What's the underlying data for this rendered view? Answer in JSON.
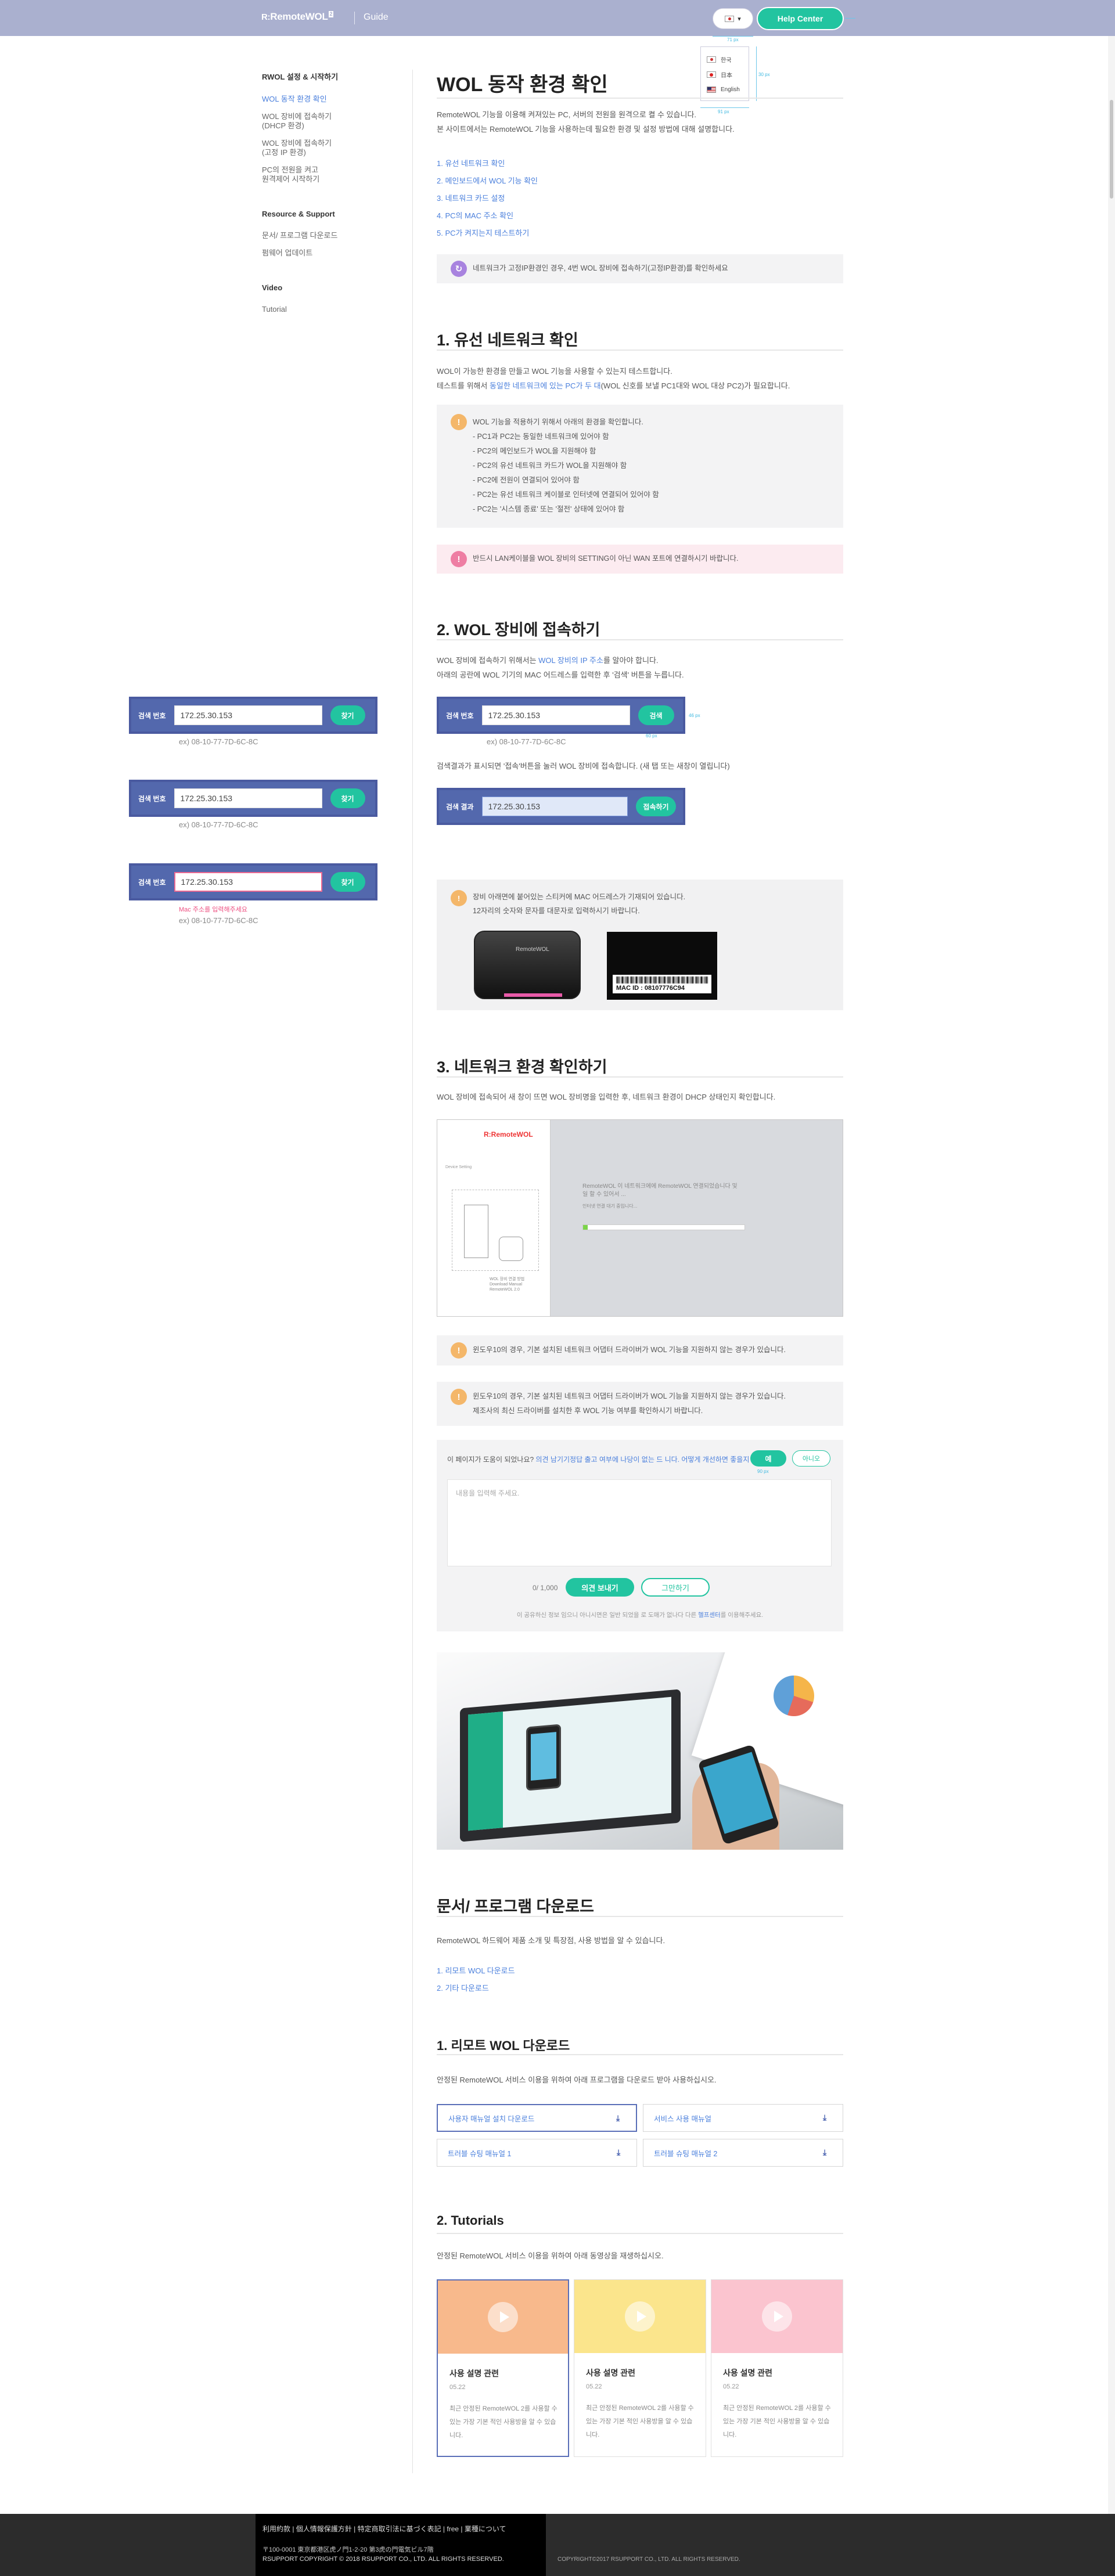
{
  "header": {
    "logo_mark": "R:",
    "logo_text": "RemoteWOL",
    "logo_version": "2",
    "guide": "Guide",
    "lang_code": "KR",
    "help": "Help Center"
  },
  "lang_menu": [
    {
      "label": "한국",
      "flag": "kr"
    },
    {
      "label": "日本",
      "flag": "jp"
    },
    {
      "label": "English",
      "flag": "us"
    }
  ],
  "dims": {
    "lang_w": "71 px",
    "lang_h": "30 px",
    "lang_w2": "91 px",
    "gap": "7 px",
    "btn_w": "46 px",
    "btn_w2": "60 px",
    "btn_w3": "90 px"
  },
  "sidebar": {
    "sec1": "RWOL 설정 & 시작하기",
    "items1": [
      "WOL 동작 환경 확인",
      "WOL 장비에 접속하기\n(DHCP 환경)",
      "WOL 장비에 접속하기\n(고정 IP 환경)",
      "PC의 전원을 켜고\n원격제어 시작하기"
    ],
    "sec2": "Resource & Support",
    "items2": [
      "문서/ 프로그램 다운로드",
      "펌웨어 업데이트"
    ],
    "sec3": "Video",
    "items3": [
      "Tutorial"
    ]
  },
  "s_main": {
    "title": "WOL 동작 환경 확인",
    "intro1": "RemoteWOL 기능을 이용해 켜져있는 PC, 서버의 전원을 원격으로 켤 수 있습니다.",
    "intro2": "본 사이트에서는 RemoteWOL 기능을 사용하는데 필요한 환경 및 설정 방법에 대해 설명합니다.",
    "toc": [
      "1. 유선 네트워크 확인",
      "2. 메인보드에서 WOL 기능 확인",
      "3. 네트워크 카드 설정",
      "4. PC의 MAC 주소 확인",
      "5. PC가 켜지는지 테스트하기"
    ],
    "toc_note": "네트워크가 고정IP환경인 경우, 4번 WOL 장비에 접속하기(고정IP환경)를 확인하세요"
  },
  "s1": {
    "title": "1. 유선 네트워크 확인",
    "p1": "WOL이 가능한 환경을 만들고 WOL 기능을 사용할 수 있는지 테스트합니다.",
    "p2a": "테스트를 위해서 ",
    "p2b": "동일한 네트워크에 있는 PC가 두 대",
    "p2c": "(WOL 신호를 보낼 PC1대와 WOL 대상 PC2)가 필요합니다.",
    "note_head": "WOL 기능을 적용하기 위해서 아래의 환경을 확인합니다.",
    "note_items": [
      "- PC1과 PC2는 동일한 네트워크에 있어야 함",
      "- PC2의 메인보드가 WOL을 지원해야 함",
      "- PC2의 유선 네트워크 카드가 WOL을 지원해야 함",
      "- PC2에 전원이 연결되어 있어야 함",
      "- PC2는 유선 네트워크 케이블로 인터넷에 연결되어 있어야 함",
      "- PC2는 '시스템 종료' 또는 '절전' 상태에 있어야 함"
    ],
    "warn": "반드시 LAN케이블을 WOL 장비의 SETTING이 아닌 WAN 포트에 연결하시기 바랍니다."
  },
  "s2": {
    "title": "2. WOL 장비에 접속하기",
    "p1a": "WOL 장비에 접속하기 위해서는 ",
    "p1b": "WOL 장비의 IP 주소",
    "p1c": "를 알아야 합니다.",
    "p2": "아래의 공란에 WOL 기기의 MAC 어드레스를 입력한 후 '검색' 버튼을 누릅니다.",
    "search_label": "검색 번호",
    "result_label": "검색 결과",
    "ip": "172.25.30.153",
    "btn_search": "검색",
    "btn_find": "찾기",
    "btn_connect": "접속하기",
    "example": "ex) 08-10-77-7D-6C-8C",
    "err": "Mac 주소를 입력해주세요",
    "p3": "검색결과가 표시되면 '접속'버튼을 눌러 WOL 장비에 접속합니다. (새 탭 또는 새창이 열립니다)",
    "note1": "장비 아래면에 붙어있는 스티커에 MAC 어드레스가 기재되어 있습니다.",
    "note2": "12자리의 숫자와 문자를 대문자로 입력하시기 바랍니다.",
    "router_logo": "RemoteWOL",
    "mac_label": "MAC ID : 08107776C94"
  },
  "s3": {
    "title": "3. 네트워크 환경 확인하기",
    "p1": "WOL 장비에 접속되어 새 창이 뜨면 WOL 장비명을 입력한 후, 네트워크 환경이 DHCP 상태인지 확인합니다.",
    "screen_brand_a": "R:",
    "screen_brand_b": "RemoteWOL",
    "screen_mini": "Device Setting",
    "screen_msg1": "RemoteWOL 이 네트워크에에 RemoteWOL 연결되었습니다 및",
    "screen_msg2": "일 할 수 있어서 ... ",
    "screen_msg3": "인터넷 연결 대기 중입니다...",
    "screen_progress": 0.03,
    "screen_cap": "WOL 장비 연결 방법\nDownload Manual\nRemoteWOL 2.0",
    "note1": "윈도우10의 경우, 기본 설치된 네트워크 어댑터 드라이버가 WOL 기능을 지원하지 않는 경우가 있습니다.",
    "note2a": "윈도우10의 경우, 기본 설치된 네트워크 어댑터 드라이버가 WOL 기능을 지원하지 않는 경우가 있습니다.",
    "note2b": "제조사의 최신 드라이버를 설치한 후 WOL 기능 여부를 확인하시기 바랍니다."
  },
  "feedback": {
    "q_a": "이 페이지가 도움이 되었나요? ",
    "q_b": "의견 남기기",
    "q_c": "정답 출고 여부에 나당이 없는 드 니다. 어떻게 개선하면 좋을지 알려주세요.",
    "yes": "예",
    "no": "아니오",
    "placeholder": "내용을 입력해 주세요.",
    "count": "0/ 1,000",
    "send": "의견 보내기",
    "cancel": "그만하기",
    "foot_a": "이 공유하신 정보 임으니 아니시면은  ",
    "foot_b": "일반 되었을 로 도매가 없나다 다른 ",
    "foot_c": "헬프센터",
    "foot_d": "를 이용해주세요."
  },
  "docs": {
    "title": "문서/ 프로그램 다운로드",
    "p1": "RemoteWOL 하드웨어 제품 소개 및 특장점, 사용 방법을 알 수 있습니다.",
    "toc": [
      "1. 리모트 WOL 다운로드",
      "2. 기타 다운로드"
    ],
    "sub1": "1. 리모트 WOL 다운로드",
    "sub1_p": "안정된 RemoteWOL 서비스 이용을 위하여 아래 프로그램을 다운로드 받아 사용하십시오.",
    "buttons": [
      "사용자 매뉴얼 설치 다운로드",
      "서비스 사용 매뉴얼",
      "트러블 슈팅 매뉴얼 1",
      "트러블 슈팅 매뉴얼 2"
    ],
    "sub2": "2. Tutorials",
    "sub2_p": "안정된 RemoteWOL 서비스 이용을 위하여 아래 동영상을 재생하십시오."
  },
  "cards": [
    {
      "title": "사용 설명 관련",
      "date": "05.22",
      "desc": "최근 안정된 RemoteWOL 2를 사용할 수 있는 가장 기본 적인 사용방을 알 수 있습니다.",
      "color": "#f8b98c"
    },
    {
      "title": "사용 설명 관련",
      "date": "05.22",
      "desc": "최근 안정된 RemoteWOL 2를 사용할 수 있는 가장 기본 적인 사용방을 알 수 있습니다.",
      "color": "#fbe58c"
    },
    {
      "title": "사용 설명 관련",
      "date": "05.22",
      "desc": "최근 안정된 RemoteWOL 2를 사용할 수 있는 가장 기본 적인 사용방을 알 수 있습니다.",
      "color": "#fbc4cf"
    }
  ],
  "footer": {
    "links": "利用約款 | 個人情報保護方針 | 特定商取引法に基づく表記 | free | 業種について",
    "addr": "〒100-0001 東京都港区虎ノ門1-2-20 第3虎の門電気ビル7階",
    "copy": "RSUPPORT  COPYRIGHT © 2018 RSUPPORT CO., LTD. ALL RIGHTS RESERVED.",
    "copy2": "COPYRIGHT©2017 RSUPPORT CO., LTD. ALL RIGHTS RESERVED."
  }
}
